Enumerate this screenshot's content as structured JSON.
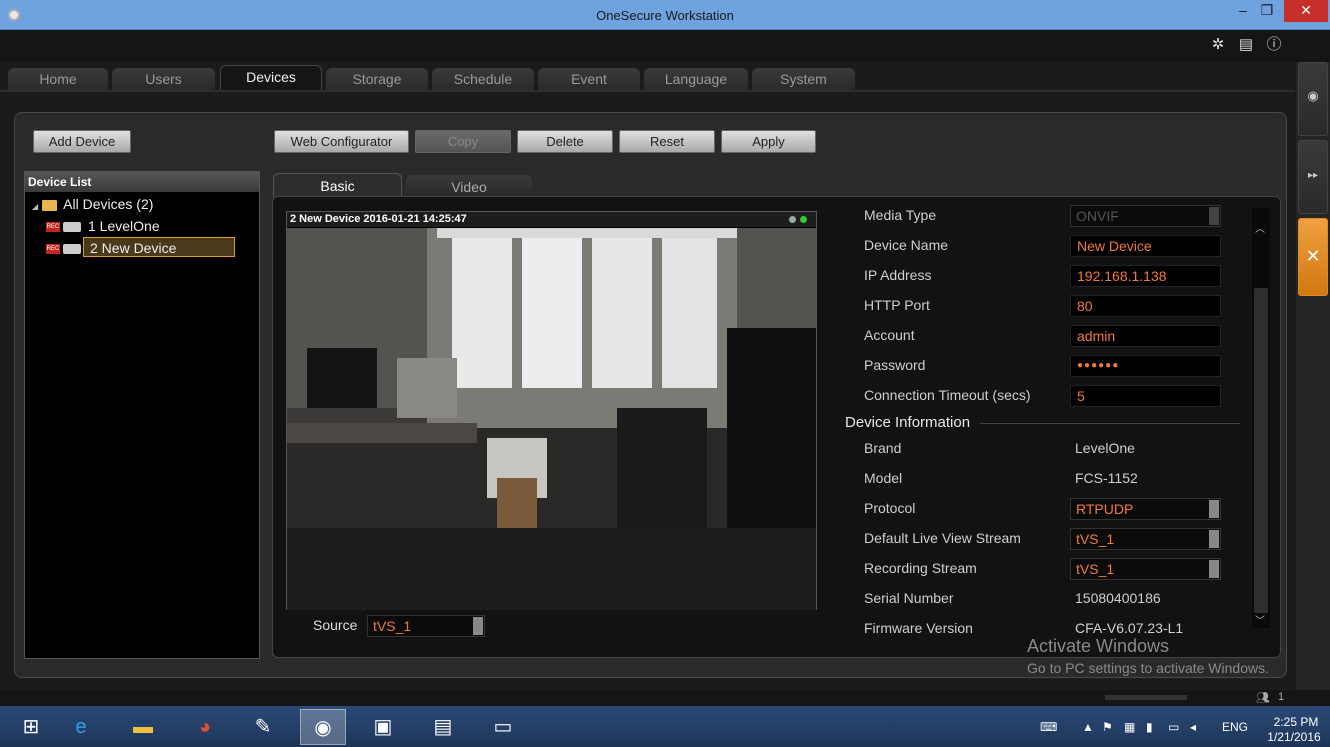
{
  "window": {
    "title": "OneSecure Workstation",
    "min_icon": "–",
    "max_icon": "❐",
    "close_icon": "✕"
  },
  "topbar": {
    "gear_icon": "✲",
    "doc_icon": "▤",
    "info_icon": "ⓘ"
  },
  "tabs": [
    {
      "label": "Home"
    },
    {
      "label": "Users"
    },
    {
      "label": "Devices"
    },
    {
      "label": "Storage"
    },
    {
      "label": "Schedule"
    },
    {
      "label": "Event"
    },
    {
      "label": "Language"
    },
    {
      "label": "System"
    }
  ],
  "toolbar": {
    "add_device": "Add Device",
    "web_configurator": "Web Configurator",
    "copy": "Copy",
    "delete": "Delete",
    "reset": "Reset",
    "apply": "Apply"
  },
  "device_list": {
    "header": "Device List",
    "root": "All Devices (2)",
    "devices": [
      {
        "label": "1 LevelOne"
      },
      {
        "label": "2 New Device"
      }
    ]
  },
  "subtabs": {
    "basic": "Basic",
    "video": "Video"
  },
  "video": {
    "header": "2 New Device  2016-01-21 14:25:47",
    "source_label": "Source",
    "source_value": "tVS_1"
  },
  "settings": {
    "media_type_label": "Media Type",
    "media_type_value": "ONVIF",
    "device_name_label": "Device Name",
    "device_name_value": "New Device",
    "ip_label": "IP Address",
    "ip_value": "192.168.1.138",
    "http_port_label": "HTTP Port",
    "http_port_value": "80",
    "account_label": "Account",
    "account_value": "admin",
    "password_label": "Password",
    "password_value": "●●●●●●",
    "timeout_label": "Connection Timeout (secs)",
    "timeout_value": "5"
  },
  "device_info": {
    "section": "Device Information",
    "brand_label": "Brand",
    "brand_value": "LevelOne",
    "model_label": "Model",
    "model_value": "FCS-1152",
    "protocol_label": "Protocol",
    "protocol_value": "RTPUDP",
    "live_stream_label": "Default Live View Stream",
    "live_stream_value": "tVS_1",
    "rec_stream_label": "Recording Stream",
    "rec_stream_value": "tVS_1",
    "serial_label": "Serial Number",
    "serial_value": "15080400186",
    "firmware_label": "Firmware Version",
    "firmware_value": "CFA-V6.07.23-L1"
  },
  "watermark": {
    "line1": "Activate Windows",
    "line2": "Go to PC settings to activate Windows."
  },
  "status": {
    "users_count": "1"
  },
  "tray": {
    "lang": "ENG",
    "time": "2:25 PM",
    "date": "1/21/2016"
  }
}
